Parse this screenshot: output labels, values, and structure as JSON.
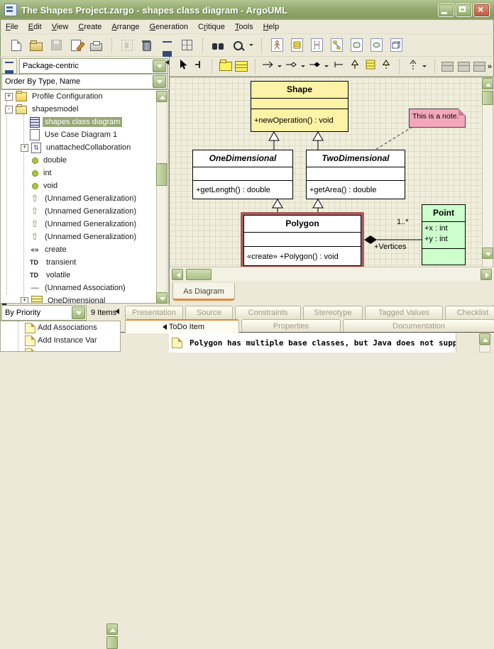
{
  "window": {
    "title": "The Shapes Project.zargo - shapes class diagram - ArgoUML",
    "controls": [
      "minimize",
      "maximize",
      "close"
    ]
  },
  "menu": {
    "items": [
      {
        "label": "File",
        "accel": 0
      },
      {
        "label": "Edit",
        "accel": 0
      },
      {
        "label": "View",
        "accel": 0
      },
      {
        "label": "Create",
        "accel": 0
      },
      {
        "label": "Arrange",
        "accel": 0
      },
      {
        "label": "Generation",
        "accel": 0
      },
      {
        "label": "Critique",
        "accel": 1
      },
      {
        "label": "Tools",
        "accel": 0
      },
      {
        "label": "Help",
        "accel": 0
      }
    ]
  },
  "toolbar": {
    "groups": [
      [
        {
          "name": "new-project"
        },
        {
          "name": "open-project"
        },
        {
          "name": "save-project",
          "disabled": true
        },
        {
          "name": "project-settings"
        },
        {
          "name": "print"
        }
      ],
      [
        {
          "name": "remove-from-diagram",
          "disabled": true
        },
        {
          "name": "delete-from-model"
        },
        {
          "name": "todo-list"
        },
        {
          "name": "settings-grid"
        }
      ],
      [
        {
          "name": "find"
        },
        {
          "name": "zoom",
          "dropdown": true
        }
      ],
      [
        {
          "name": "new-usecase-diagram"
        },
        {
          "name": "new-class-diagram"
        },
        {
          "name": "new-sequence-diagram"
        },
        {
          "name": "new-collaboration-diagram"
        },
        {
          "name": "new-statechart-diagram"
        },
        {
          "name": "new-activity-diagram"
        },
        {
          "name": "new-deployment-diagram"
        }
      ]
    ]
  },
  "explorer": {
    "perspective": "Package-centric",
    "ordering": "Order By Type, Name",
    "tree": [
      {
        "label": "Profile Configuration",
        "icon": "folder",
        "expander": "plus",
        "indent": 0
      },
      {
        "label": "shapesmodel",
        "icon": "package",
        "expander": "minus",
        "indent": 0
      },
      {
        "label": "shapes class diagram",
        "icon": "class-diagram",
        "indent": 1,
        "selected": true
      },
      {
        "label": "Use Case Diagram 1",
        "icon": "usecase-diagram",
        "indent": 1
      },
      {
        "label": "unattachedCollaboration",
        "icon": "collaboration",
        "expander": "plus",
        "indent": 1
      },
      {
        "label": "double",
        "icon": "datatype",
        "indent": 1
      },
      {
        "label": "int",
        "icon": "datatype",
        "indent": 1
      },
      {
        "label": "void",
        "icon": "datatype",
        "indent": 1
      },
      {
        "label": "(Unnamed Generalization)",
        "icon": "generalization",
        "indent": 1
      },
      {
        "label": "(Unnamed Generalization)",
        "icon": "generalization",
        "indent": 1
      },
      {
        "label": "(Unnamed Generalization)",
        "icon": "generalization",
        "indent": 1
      },
      {
        "label": "(Unnamed Generalization)",
        "icon": "generalization",
        "indent": 1
      },
      {
        "label": "create",
        "icon": "stereotype",
        "indent": 1
      },
      {
        "label": "transient",
        "icon": "tag-definition",
        "indent": 1
      },
      {
        "label": "volatile",
        "icon": "tag-definition",
        "indent": 1
      },
      {
        "label": "(Unnamed Association)",
        "icon": "association",
        "indent": 1
      },
      {
        "label": "OneDimensional",
        "icon": "class",
        "expander": "plus",
        "indent": 1
      }
    ]
  },
  "diagram_toolbar": {
    "items": [
      {
        "name": "select-tool"
      },
      {
        "name": "broom-tool"
      },
      {
        "sep": true
      },
      {
        "name": "package-tool"
      },
      {
        "name": "class-tool"
      },
      {
        "sep": true
      },
      {
        "name": "association-tool",
        "dropdown": true
      },
      {
        "name": "aggregation-tool",
        "dropdown": true
      },
      {
        "name": "composition-tool",
        "dropdown": true
      },
      {
        "name": "uniassociation-tool"
      },
      {
        "name": "generalization-tool"
      },
      {
        "name": "class-compartments-tool"
      },
      {
        "name": "realization-tool"
      },
      {
        "sep": true
      },
      {
        "name": "dependency-tool",
        "dropdown": true
      },
      {
        "sep": true
      },
      {
        "name": "new-attribute-tool"
      },
      {
        "name": "new-operation-tool"
      },
      {
        "name": "new-datatype-tool"
      }
    ],
    "overflow": "»"
  },
  "editor": {
    "tab_label": "As Diagram",
    "diagram": {
      "classes": [
        {
          "name": "Shape",
          "attributes": [],
          "operations": [
            "+newOperation() : void"
          ]
        },
        {
          "name": "OneDimensional",
          "abstract": true,
          "operations": [
            "+getLength() : double"
          ]
        },
        {
          "name": "TwoDimensional",
          "abstract": true,
          "operations": [
            "+getArea() : double"
          ]
        },
        {
          "name": "Polygon",
          "selected": true,
          "operations": [
            "«create» +Polygon() : void"
          ]
        },
        {
          "name": "Point",
          "attributes": [
            "+x : int",
            "+y : int"
          ],
          "operations": []
        }
      ],
      "note_text": "This is a note.",
      "association": {
        "multiplicity": "1..*",
        "role": "+Vertices"
      }
    }
  },
  "todo_pane": {
    "filter": "By Priority",
    "count": "9 Items",
    "items": [
      "Add Associations",
      "Add Instance Var"
    ],
    "partial_third_item": true
  },
  "details": {
    "tabs_row1": [
      "Presentation",
      "Source",
      "Constraints",
      "Stereotype",
      "Tagged Values",
      "Checklist"
    ],
    "tabs_row2": [
      "ToDo Item",
      "Properties",
      "Documentation"
    ],
    "active_tab": "ToDo Item",
    "todo_text": "Polygon has multiple base classes, but Java does not support"
  },
  "colors": {
    "titlebar": "#94AA6F",
    "chrome": "#ECE9D8",
    "selection": "#96A877",
    "canvas": "#F0EEDC",
    "class_yellow": "#FDF3A6",
    "class_green": "#CCFFCC",
    "note_pink": "#F4A7BB",
    "active_tab_accent": "#E0893B",
    "polygon_selection": "#A45B5B"
  }
}
